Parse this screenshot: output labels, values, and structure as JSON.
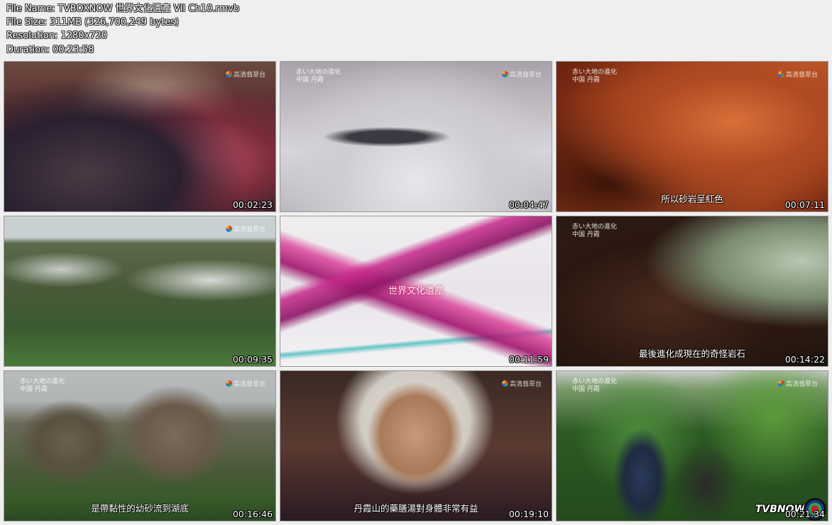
{
  "header": {
    "file_name": "File Name: TVBOXNOW 世界文化遺產 VII Ch10.rmvb",
    "file_size": "File Size: 311MB (326,700,249 bytes)",
    "resolution": "Resolution: 1280x720",
    "duration": "Duration: 00:23:58"
  },
  "channel_logo": "高清翡翠台",
  "caption_line1": "赤い大地の進化",
  "caption_line2": "中国 丹霞",
  "thumbnails": [
    {
      "time": "00:02:23",
      "subtitle": ""
    },
    {
      "time": "00:04:47",
      "subtitle": ""
    },
    {
      "time": "00:07:11",
      "subtitle": "所以砂岩呈紅色"
    },
    {
      "time": "00:09:35",
      "subtitle": ""
    },
    {
      "time": "00:11:59",
      "subtitle": "",
      "title_text": "世界文化遺產"
    },
    {
      "time": "00:14:22",
      "subtitle": "最後進化成現在的奇怪岩石"
    },
    {
      "time": "00:16:46",
      "subtitle": "是帶黏性的幼砂流到湖底"
    },
    {
      "time": "00:19:10",
      "subtitle": "丹霞山的藥膳湯對身體非常有益"
    },
    {
      "time": "00:21:34",
      "subtitle": ""
    }
  ],
  "watermark": "TVBNOW"
}
